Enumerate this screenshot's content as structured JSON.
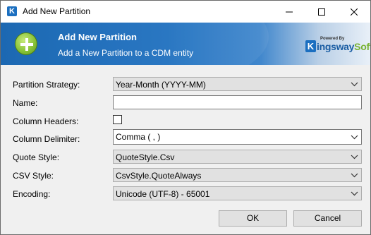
{
  "window": {
    "title": "Add New Partition",
    "app_icon_glyph": "K"
  },
  "banner": {
    "title": "Add New Partition",
    "subtitle": "Add a New Partition to a CDM entity",
    "logo_powered_by": "Powered By",
    "logo_k": "K",
    "logo_ingsway": "ingsway",
    "logo_soft": "Soft"
  },
  "form": {
    "partition_strategy": {
      "label": "Partition Strategy:",
      "value": "Year-Month (YYYY-MM)"
    },
    "name": {
      "label": "Name:",
      "value": ""
    },
    "column_headers": {
      "label": "Column Headers:",
      "checked": false
    },
    "column_delimiter": {
      "label": "Column Delimiter:",
      "value": "Comma ( , )"
    },
    "quote_style": {
      "label": "Quote Style:",
      "value": "QuoteStyle.Csv"
    },
    "csv_style": {
      "label": "CSV Style:",
      "value": "CsvStyle.QuoteAlways"
    },
    "encoding": {
      "label": "Encoding:",
      "value": "Unicode (UTF-8) - 65001"
    }
  },
  "buttons": {
    "ok": "OK",
    "cancel": "Cancel"
  },
  "colors": {
    "banner_blue": "#1d6fbf",
    "plus_green": "#8ac43a",
    "logo_blue": "#1a5da3",
    "logo_green": "#78b232"
  },
  "icons": {
    "app": "kingsway-k-icon",
    "add": "plus-circle-icon",
    "dropdown": "chevron-down-icon",
    "minimize": "minimize-icon",
    "maximize": "maximize-icon",
    "close": "close-icon"
  }
}
